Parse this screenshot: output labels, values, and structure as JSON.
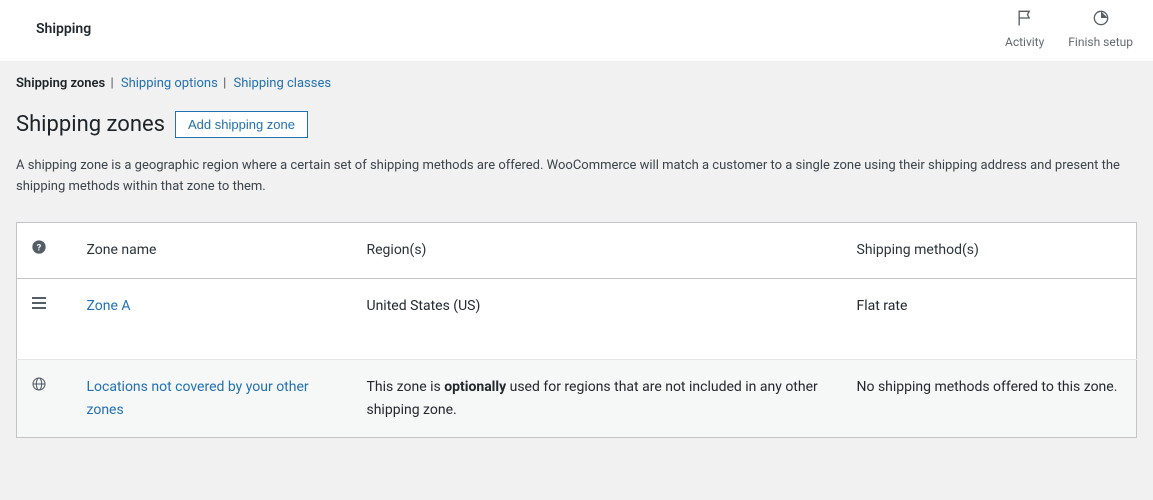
{
  "top": {
    "title": "Shipping",
    "actions": {
      "activity": "Activity",
      "finish_setup": "Finish setup"
    }
  },
  "subnav": {
    "zones": "Shipping zones",
    "options": "Shipping options",
    "classes": "Shipping classes"
  },
  "page": {
    "heading": "Shipping zones",
    "add_button": "Add shipping zone",
    "description": "A shipping zone is a geographic region where a certain set of shipping methods are offered. WooCommerce will match a customer to a single zone using their shipping address and present the shipping methods within that zone to them."
  },
  "table": {
    "headers": {
      "name": "Zone name",
      "region": "Region(s)",
      "method": "Shipping method(s)"
    },
    "rows": [
      {
        "name": "Zone A",
        "region": "United States (US)",
        "method": "Flat rate"
      }
    ],
    "default_row": {
      "name": "Locations not covered by your other zones",
      "region_prefix": "This zone is ",
      "region_bold": "optionally",
      "region_suffix": " used for regions that are not included in any other shipping zone.",
      "method": "No shipping methods offered to this zone."
    }
  }
}
